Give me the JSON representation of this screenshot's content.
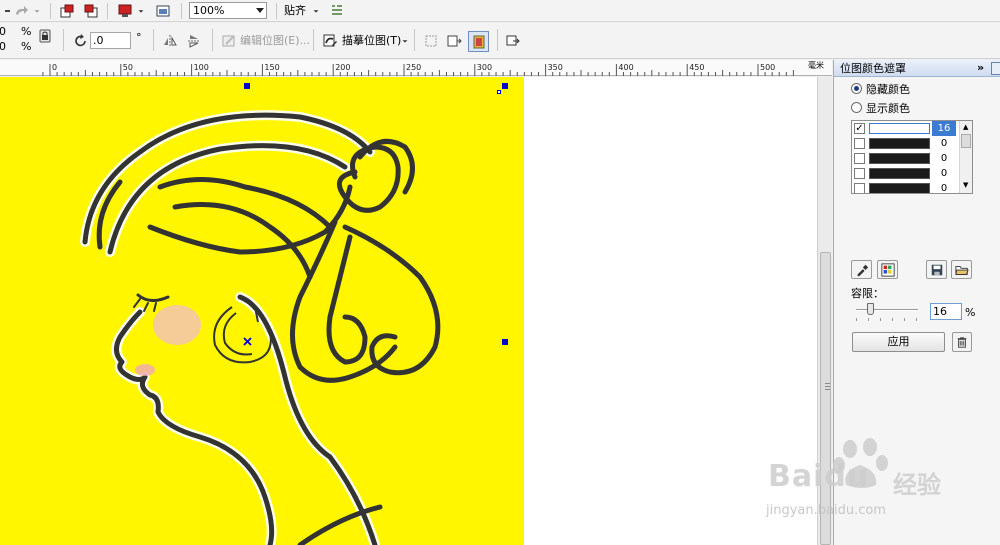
{
  "toolbar_top": {
    "zoom_value": "100%",
    "snap_label": "贴齐"
  },
  "toolbar_property": {
    "pos_x_value": "0",
    "pos_y_value": "0",
    "percent_symbol": "%",
    "rotation_value": ".0",
    "degree_symbol": "°",
    "edit_bitmap_label": "编辑位图(E)...",
    "trace_bitmap_label": "描摹位图(T)"
  },
  "ruler": {
    "ticks": [
      "0",
      "50",
      "100",
      "150",
      "200",
      "250",
      "300",
      "350",
      "400",
      "450",
      "500"
    ],
    "unit": "毫米"
  },
  "docker": {
    "title": "位图颜色遮罩",
    "hide_color_label": "隐藏颜色",
    "show_color_label": "显示颜色",
    "mode_selected": "hide",
    "color_rows": [
      {
        "checked": true,
        "swatch": "#ffffff",
        "value": "16"
      },
      {
        "checked": false,
        "swatch": "#1b1b1b",
        "value": "0"
      },
      {
        "checked": false,
        "swatch": "#1b1b1b",
        "value": "0"
      },
      {
        "checked": false,
        "swatch": "#1b1b1b",
        "value": "0"
      },
      {
        "checked": false,
        "swatch": "#1b1b1b",
        "value": "0"
      }
    ],
    "tolerance_label": "容限：",
    "tolerance_value": "16",
    "tolerance_unit": "%",
    "apply_label": "应用"
  },
  "colors": {
    "artwork_background": "#fff600",
    "line_art": "#333333",
    "accent_selection": "#3b7bd4",
    "handle": "#0000cc"
  },
  "watermark": {
    "brand": "Baidu",
    "brand_cn": "经验",
    "url": "jingyan.baidu.com"
  }
}
